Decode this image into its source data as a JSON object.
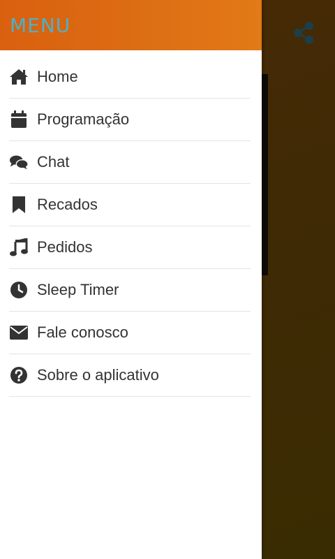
{
  "app": {
    "accent_color": "#dd6f14",
    "title_color": "#4fb0c6"
  },
  "drawer": {
    "title": "MENU",
    "items": [
      {
        "label": "Home",
        "icon": "home-icon"
      },
      {
        "label": "Programação",
        "icon": "calendar-icon"
      },
      {
        "label": "Chat",
        "icon": "chat-icon"
      },
      {
        "label": "Recados",
        "icon": "bookmark-icon"
      },
      {
        "label": "Pedidos",
        "icon": "music-icon"
      },
      {
        "label": "Sleep Timer",
        "icon": "clock-icon"
      },
      {
        "label": "Fale conosco",
        "icon": "envelope-icon"
      },
      {
        "label": "Sobre o aplicativo",
        "icon": "question-circle-icon"
      }
    ]
  },
  "background": {
    "share_icon": "share-icon"
  }
}
